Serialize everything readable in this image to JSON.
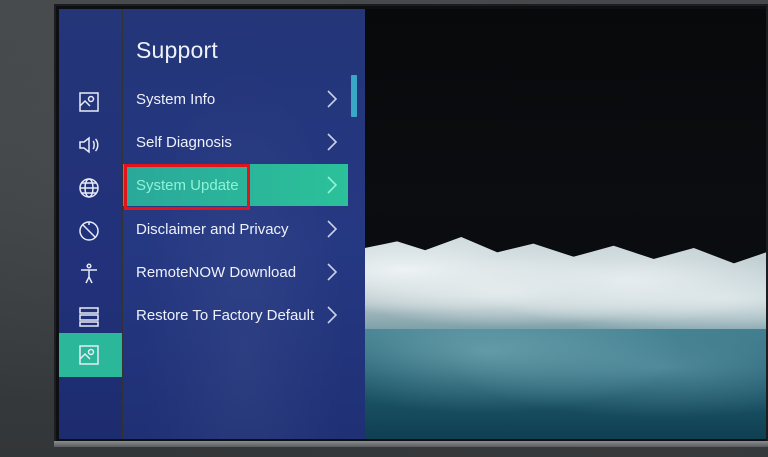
{
  "menu": {
    "title": "Support",
    "items": [
      {
        "label": "System Info"
      },
      {
        "label": "Self Diagnosis"
      },
      {
        "label": "System Update",
        "selected": true
      },
      {
        "label": "Disclaimer and Privacy"
      },
      {
        "label": "RemoteNOW Download"
      },
      {
        "label": "Restore To Factory Default"
      }
    ]
  },
  "rail": {
    "icons": [
      "picture-icon",
      "sound-icon",
      "network-icon",
      "system-icon",
      "accessibility-icon",
      "settings-list-icon",
      "support-icon"
    ],
    "active": "support-icon"
  },
  "colors": {
    "panel": "#243578",
    "accent": "#2ab79a",
    "highlight_box": "#e0141a",
    "scroll_indicator": "#3aa7c6"
  }
}
